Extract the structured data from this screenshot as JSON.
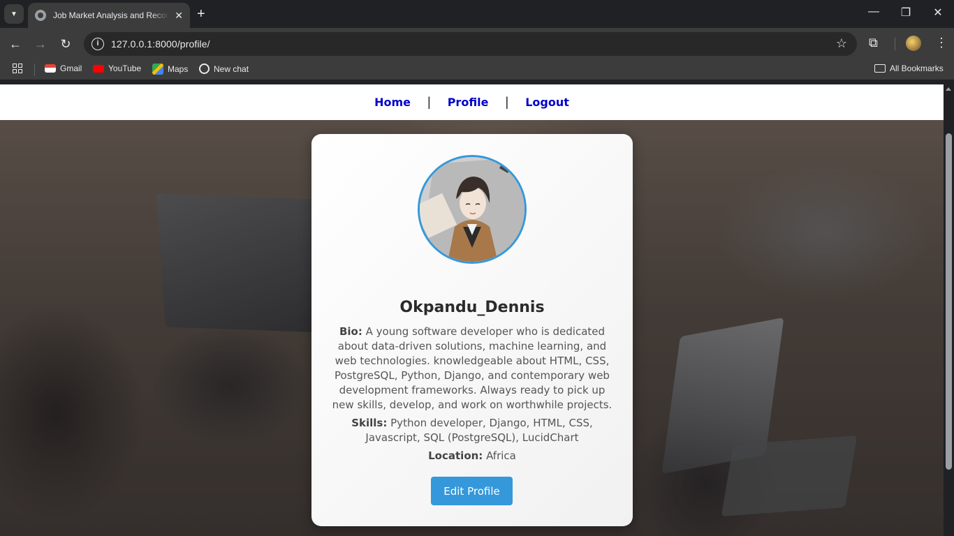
{
  "browser": {
    "tab_title": "Job Market Analysis and Recommendation",
    "url": "127.0.0.1:8000/profile/",
    "bookmarks": [
      {
        "label": "Gmail",
        "icon": "gmail-icon"
      },
      {
        "label": "YouTube",
        "icon": "youtube-icon"
      },
      {
        "label": "Maps",
        "icon": "maps-icon"
      },
      {
        "label": "New chat",
        "icon": "chatgpt-icon"
      }
    ],
    "all_bookmarks_label": "All Bookmarks"
  },
  "nav": {
    "home": "Home",
    "profile": "Profile",
    "logout": "Logout",
    "separator": "|"
  },
  "profile": {
    "username": "Okpandu_Dennis",
    "bio_label": "Bio:",
    "bio": "A young software developer who is dedicated about data-driven solutions, machine learning, and web technologies. knowledgeable about HTML, CSS, PostgreSQL, Python, Django, and contemporary web development frameworks. Always ready to pick up new skills, develop, and work on worthwhile projects.",
    "skills_label": "Skills:",
    "skills": "Python developer, Django, HTML, CSS, Javascript, SQL (PostgreSQL), LucidChart",
    "location_label": "Location:",
    "location": "Africa",
    "edit_button": "Edit Profile"
  },
  "colors": {
    "accent": "#3498db",
    "nav_link": "#0000cc",
    "chrome_dark": "#202124",
    "chrome_toolbar": "#3c3c3c"
  }
}
